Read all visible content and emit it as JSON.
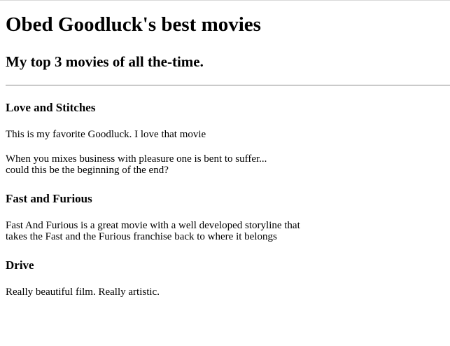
{
  "page": {
    "title": "Obed Goodluck's best movies",
    "subtitle": "My top 3 movies of all the-time."
  },
  "movies": [
    {
      "title": "Love and Stitches",
      "paragraphs": [
        [
          "This is my favorite Goodluck. I love that movie"
        ],
        [
          "When you mixes business with pleasure one is bent to suffer...",
          "could this be the beginning of the end?"
        ]
      ]
    },
    {
      "title": "Fast and Furious",
      "paragraphs": [
        [
          "Fast And Furious is a great movie with a well developed storyline that",
          "takes the Fast and the Furious franchise back to where it belongs"
        ]
      ]
    },
    {
      "title": "Drive",
      "paragraphs": [
        [
          "Really beautiful film. Really artistic."
        ]
      ]
    }
  ]
}
